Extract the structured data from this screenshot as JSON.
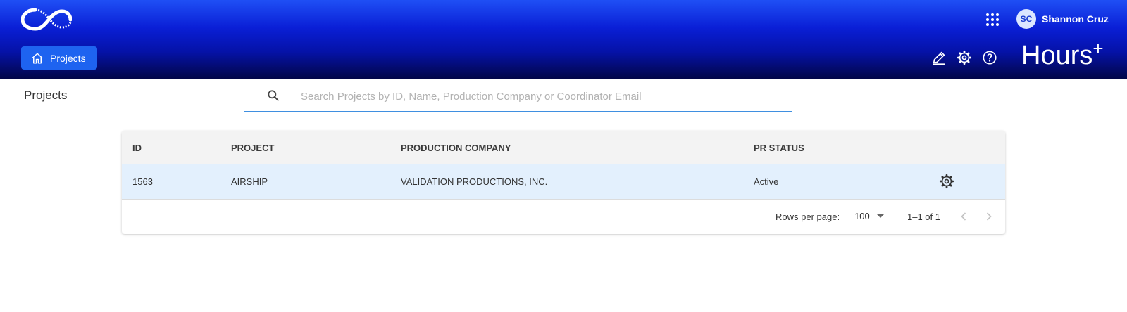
{
  "header": {
    "user": {
      "initials": "SC",
      "name": "Shannon Cruz"
    },
    "nav_button_label": "Projects",
    "brand": {
      "name": "Hours",
      "sup": "+"
    },
    "icons": [
      "logo-icon",
      "apps-grid-icon",
      "home-icon",
      "edit-pencil-icon",
      "gear-icon",
      "help-icon"
    ]
  },
  "page": {
    "title": "Projects"
  },
  "search": {
    "placeholder": "Search Projects by ID, Name, Production Company or Coordinator Email",
    "value": ""
  },
  "table": {
    "columns": [
      "ID",
      "PROJECT",
      "PRODUCTION COMPANY",
      "PR STATUS"
    ],
    "rows": [
      {
        "id": "1563",
        "project": "AIRSHIP",
        "company": "VALIDATION PRODUCTIONS, INC.",
        "status": "Active"
      }
    ],
    "footer": {
      "rows_per_page_label": "Rows per page:",
      "rows_per_page": "100",
      "range": "1–1 of 1"
    }
  },
  "colors": {
    "header_top": "#1f4ff5",
    "header_bottom": "#020645",
    "button": "#1e63f0",
    "row_highlight": "#e3f0fd",
    "search_underline": "#3f8fe0"
  }
}
